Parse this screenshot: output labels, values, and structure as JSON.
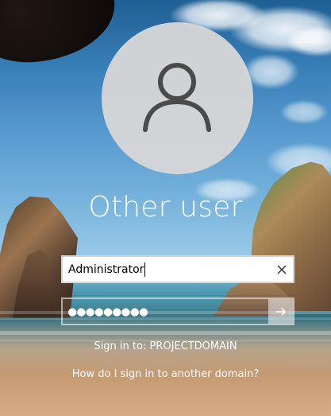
{
  "user": {
    "display_name": "Other user",
    "avatar_icon": "user-icon"
  },
  "login": {
    "username_value": "Administrator",
    "clear_icon": "clear-icon",
    "password_mask": "●●●●●●●●●",
    "submit_icon": "arrow-right-icon"
  },
  "info": {
    "sign_in_to": "Sign in to: PROJECTDOMAIN",
    "help_link": "How do I sign in to another domain?"
  }
}
